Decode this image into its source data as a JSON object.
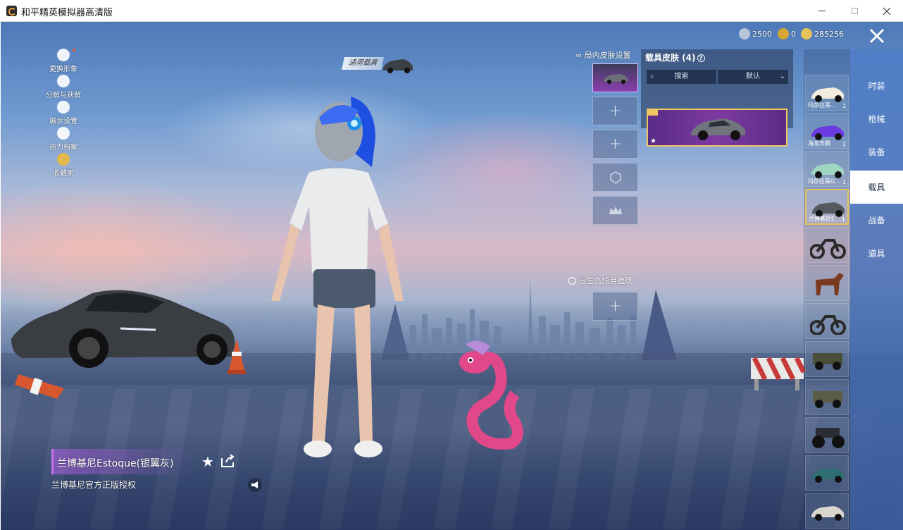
{
  "window": {
    "title": "和平精英模拟器高清版"
  },
  "currency": [
    {
      "icon": "silver-coin-icon",
      "value": "2500",
      "color": "#b8c4d8"
    },
    {
      "icon": "gold-medal-icon",
      "value": "0",
      "color": "#d7a634"
    },
    {
      "icon": "gold-coin-icon",
      "value": "285256",
      "color": "#e6c25a"
    }
  ],
  "left_menu": [
    {
      "label": "更换形象",
      "icon": "avatar-icon"
    },
    {
      "label": "分解与获解",
      "icon": "puzzle-icon"
    },
    {
      "label": "展示设置",
      "icon": "eye-icon"
    },
    {
      "label": "热力档案",
      "icon": "flame-icon"
    },
    {
      "label": "收藏家",
      "icon": "collector-badge-icon"
    }
  ],
  "suit_tag": "适用载具",
  "in_game_skin": {
    "title": "局内皮肤设置"
  },
  "spawn_island": {
    "title": "出生岛炫目登场"
  },
  "skin_panel": {
    "title": "载具皮肤 (4)",
    "search_label": "搜索",
    "sort_label": "默认"
  },
  "categories": [
    {
      "label": "时装",
      "active": false
    },
    {
      "label": "枪械",
      "active": false
    },
    {
      "label": "装备",
      "active": false
    },
    {
      "label": "载具",
      "active": true
    },
    {
      "label": "战备",
      "active": false
    },
    {
      "label": "道具",
      "active": false
    }
  ],
  "vehicles": [
    {
      "name": "玛莎拉蒂...",
      "count": "1",
      "color": "#f2ecdf",
      "type": "car"
    },
    {
      "name": "海龙奔腾",
      "count": "1",
      "color": "#6a3be0",
      "type": "car"
    },
    {
      "name": "玛莎拉蒂G...",
      "count": "1",
      "color": "#9fd6c2",
      "type": "car"
    },
    {
      "name": "兰博基尼E...",
      "count": "1",
      "color": "#555a60",
      "type": "car",
      "selected": true
    },
    {
      "name": "",
      "count": "",
      "color": "#2b2b2b",
      "type": "moto"
    },
    {
      "name": "",
      "count": "",
      "color": "#7a3b20",
      "type": "horse"
    },
    {
      "name": "",
      "count": "",
      "color": "#2b2b2b",
      "type": "moto"
    },
    {
      "name": "",
      "count": "",
      "color": "#4a4f3a",
      "type": "jeep"
    },
    {
      "name": "",
      "count": "",
      "color": "#5a5e46",
      "type": "jeep"
    },
    {
      "name": "",
      "count": "",
      "color": "#2a2d33",
      "type": "monster"
    },
    {
      "name": "",
      "count": "",
      "color": "#2f6e72",
      "type": "car"
    },
    {
      "name": "",
      "count": "",
      "color": "#d9d6cf",
      "type": "car"
    }
  ],
  "vehicle_info": {
    "name": "兰博基尼Estoque(银翼灰)",
    "license": "兰博基尼官方正版授权"
  }
}
